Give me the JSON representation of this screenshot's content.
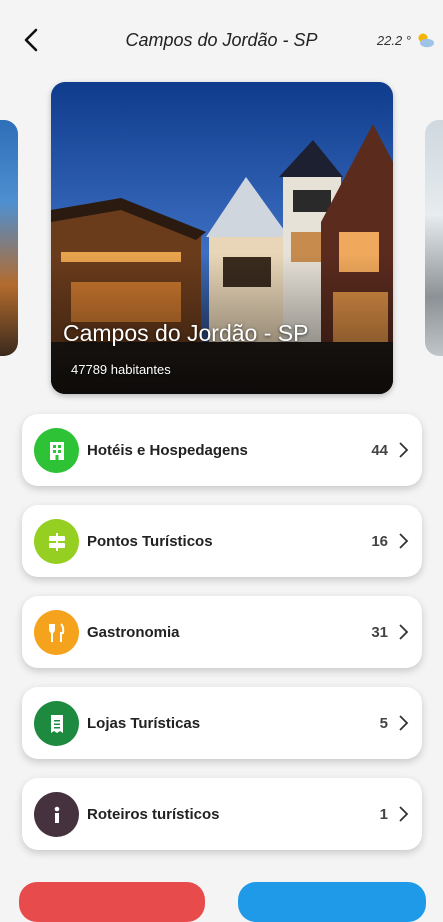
{
  "header": {
    "title": "Campos do Jordão - SP",
    "weather": "22.2 °"
  },
  "featured": {
    "city": "Campos do Jordão - SP",
    "population": "47789 habitantes"
  },
  "categories": [
    {
      "label": "Hotéis e Hospedagens",
      "count": "44",
      "color": "#2ec236",
      "icon": "hotel-icon"
    },
    {
      "label": "Pontos Turísticos",
      "count": "16",
      "color": "#95cf21",
      "icon": "signpost-icon"
    },
    {
      "label": "Gastronomia",
      "count": "31",
      "color": "#f5a21c",
      "icon": "fork-knife-icon"
    },
    {
      "label": "Lojas Turísticas",
      "count": "5",
      "color": "#1e8a3f",
      "icon": "receipt-icon"
    },
    {
      "label": "Roteiros turísticos",
      "count": "1",
      "color": "#45323e",
      "icon": "info-icon"
    }
  ],
  "colors": {
    "background": "#f4f4f4",
    "bottom_left": "#e84b4b",
    "bottom_right": "#1f9ae8"
  }
}
